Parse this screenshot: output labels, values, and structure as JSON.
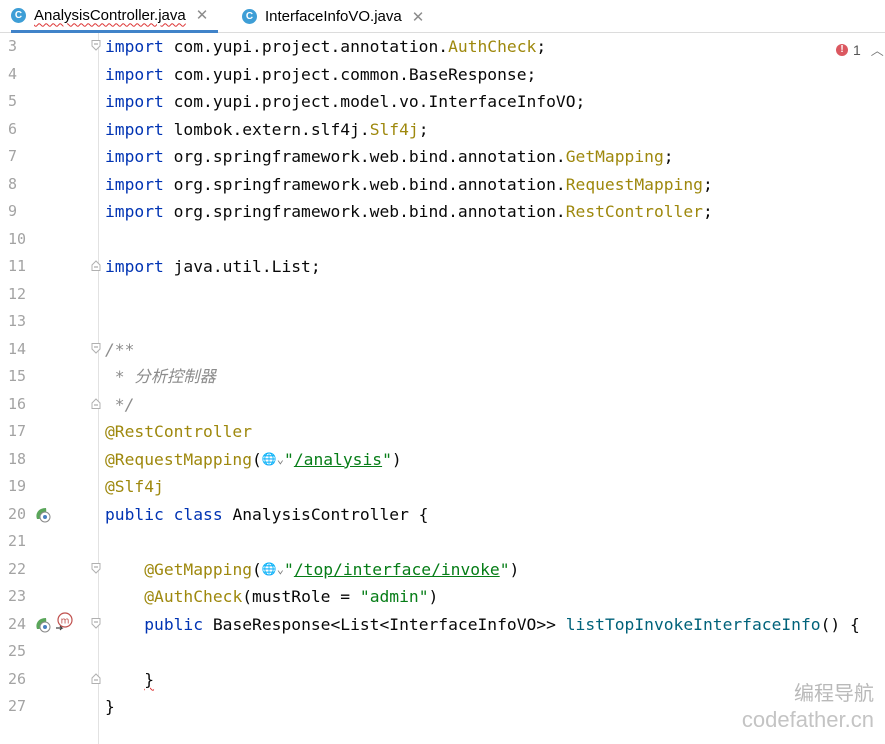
{
  "tabs": [
    {
      "label": "AnalysisController.java",
      "icon": "class-icon",
      "active": true
    },
    {
      "label": "InterfaceInfoVO.java",
      "icon": "class-icon",
      "active": false
    }
  ],
  "inspection": {
    "error_count": "1"
  },
  "lines": [
    {
      "num": "3",
      "html": "<span class=\"kw\">import</span> com.yupi.project.annotation.<span class=\"ann\">AuthCheck</span>;",
      "fold": "open"
    },
    {
      "num": "4",
      "html": "<span class=\"kw\">import</span> com.yupi.project.common.BaseResponse;"
    },
    {
      "num": "5",
      "html": "<span class=\"kw\">import</span> com.yupi.project.model.vo.InterfaceInfoVO;"
    },
    {
      "num": "6",
      "html": "<span class=\"kw\">import</span> lombok.extern.slf4j.<span class=\"ann\">Slf4j</span>;"
    },
    {
      "num": "7",
      "html": "<span class=\"kw\">import</span> org.springframework.web.bind.annotation.<span class=\"ann\">GetMapping</span>;"
    },
    {
      "num": "8",
      "html": "<span class=\"kw\">import</span> org.springframework.web.bind.annotation.<span class=\"ann\">RequestMapping</span>;"
    },
    {
      "num": "9",
      "html": "<span class=\"kw\">import</span> org.springframework.web.bind.annotation.<span class=\"ann\">RestController</span>;"
    },
    {
      "num": "10",
      "html": ""
    },
    {
      "num": "11",
      "html": "<span class=\"kw\">import</span> java.util.List;",
      "fold": "close"
    },
    {
      "num": "12",
      "html": ""
    },
    {
      "num": "13",
      "html": ""
    },
    {
      "num": "14",
      "html": "<span class=\"cmt\">/**</span>",
      "fold": "open"
    },
    {
      "num": "15",
      "html": "<span class=\"cmt\"> * 分析控制器</span>"
    },
    {
      "num": "16",
      "html": "<span class=\"cmt\"> */</span>",
      "fold": "close"
    },
    {
      "num": "17",
      "html": "<span class=\"ann\">@RestController</span>"
    },
    {
      "num": "18",
      "html": "<span class=\"ann\">@RequestMapping</span>(<span class=\"globe\">🌐⌄</span><span class=\"str\">\"<span class=\"lnk\">/analysis</span>\"</span>)"
    },
    {
      "num": "19",
      "html": "<span class=\"ann\">@Slf4j</span>"
    },
    {
      "num": "20",
      "html": "<span class=\"kw\">public class</span> AnalysisController {",
      "gutter": "bean"
    },
    {
      "num": "21",
      "html": ""
    },
    {
      "num": "22",
      "html": "    <span class=\"ann\">@GetMapping</span>(<span class=\"globe\">🌐⌄</span><span class=\"str\">\"<span class=\"lnk\">/top/interface/invoke</span>\"</span>)",
      "fold": "open"
    },
    {
      "num": "23",
      "html": "    <span class=\"ann\">@AuthCheck</span>(mustRole = <span class=\"str\">\"admin\"</span>)"
    },
    {
      "num": "24",
      "html": "    <span class=\"kw\">public</span> BaseResponse&lt;List&lt;InterfaceInfoVO&gt;&gt; <span class=\"fn\">listTopInvokeInterfaceInfo</span>() {",
      "gutter": "bean-mapping",
      "fold": "open"
    },
    {
      "num": "25",
      "html": ""
    },
    {
      "num": "26",
      "html": "    <span class=\"squig\">}</span>",
      "fold": "close"
    },
    {
      "num": "27",
      "html": "}"
    }
  ],
  "watermark": {
    "line1": "编程导航",
    "line2": "codefather.cn"
  },
  "colors": {
    "keyword": "#0033b3",
    "annotation": "#9e880d",
    "string": "#067d17",
    "comment": "#8c8c8c",
    "method": "#00627a",
    "tab_accent": "#4083c9"
  }
}
